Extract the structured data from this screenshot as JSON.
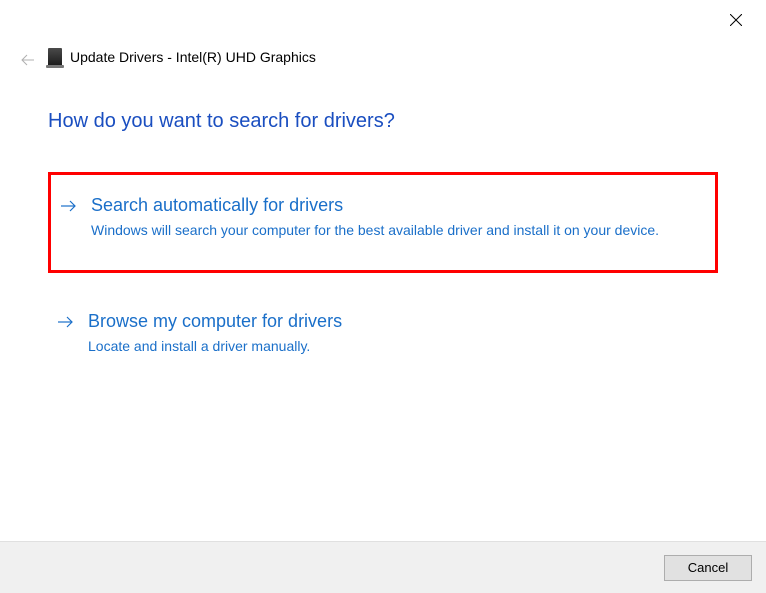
{
  "header": {
    "title": "Update Drivers - Intel(R) UHD Graphics"
  },
  "main_heading": "How do you want to search for drivers?",
  "options": [
    {
      "title": "Search automatically for drivers",
      "description": "Windows will search your computer for the best available driver and install it on your device."
    },
    {
      "title": "Browse my computer for drivers",
      "description": "Locate and install a driver manually."
    }
  ],
  "footer": {
    "cancel_label": "Cancel"
  }
}
